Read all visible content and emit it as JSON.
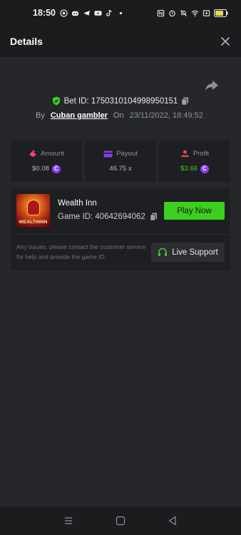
{
  "status_bar": {
    "time": "18:50",
    "left_icons": [
      "whatsapp-icon",
      "discord-icon",
      "telegram-icon",
      "youtube-icon",
      "tiktok-icon",
      "dot-icon"
    ],
    "right_icons": [
      "nfc-icon",
      "alarm-icon",
      "mute-icon",
      "wifi-icon",
      "screen-icon",
      "battery-icon"
    ],
    "battery_level": "68"
  },
  "header": {
    "title": "Details"
  },
  "bet": {
    "bet_id_label": "Bet ID: 1750310104998950151",
    "by_label": "By",
    "user": "Cuban gambler",
    "on_label": "On",
    "date": "23/11/2022, 18:49:52"
  },
  "stats": [
    {
      "label": "Amount",
      "value": "$0.08",
      "icon": "amount-icon",
      "color": "#e8437a",
      "coin": true,
      "green": false
    },
    {
      "label": "Payout",
      "value": "46.75 x",
      "icon": "payout-icon",
      "color": "#8a3df0",
      "coin": false,
      "green": false
    },
    {
      "label": "Profit",
      "value": "$3.66",
      "icon": "profit-icon",
      "color": "#e24a4a",
      "coin": true,
      "green": true
    }
  ],
  "coin_symbol": "C",
  "game": {
    "name": "Wealth Inn",
    "game_id_label": "Game ID: 40642694062",
    "thumb_text": "WEALTHINN",
    "play_label": "Play Now",
    "issue_text": "Any issues, please contact the customer service for help and provide the game ID.",
    "support_label": "Live Support"
  },
  "colors": {
    "accent_green": "#3dcf1f",
    "background": "#25272a",
    "card": "#1e1f22"
  }
}
